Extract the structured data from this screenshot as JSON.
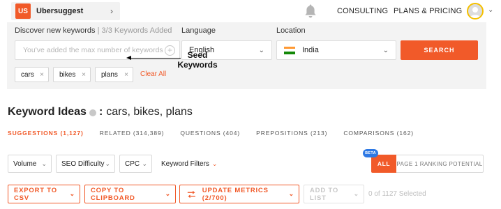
{
  "topbar": {
    "project_badge": "US",
    "project_name": "Ubersuggest",
    "project_chevron": "›",
    "consulting": "CONSULTING",
    "plans_pricing": "PLANS & PRICING",
    "avatar_chevron": "⌄"
  },
  "search": {
    "discover_label": "Discover new keywords",
    "keywords_added": "| 3/3 Keywords Added",
    "input_placeholder": "You've added the max number of keywords",
    "language_label": "Language",
    "language_value": "English",
    "location_label": "Location",
    "location_value": "India",
    "search_button": "SEARCH",
    "seed_keywords": [
      {
        "text": "cars",
        "remove": "×"
      },
      {
        "text": "bikes",
        "remove": "×"
      },
      {
        "text": "plans",
        "remove": "×"
      }
    ],
    "clear_all": "Clear All"
  },
  "annotation": {
    "text": "Seed Keywords"
  },
  "ideas": {
    "title": "Keyword Ideas",
    "colon": ":",
    "keywords": "cars, bikes, plans",
    "tabs": [
      {
        "label": "SUGGESTIONS (1,127)",
        "active": true
      },
      {
        "label": "RELATED (314,389)",
        "active": false
      },
      {
        "label": "QUESTIONS (404)",
        "active": false
      },
      {
        "label": "PREPOSITIONS (213)",
        "active": false
      },
      {
        "label": "COMPARISONS (162)",
        "active": false
      }
    ]
  },
  "filters": {
    "volume": "Volume",
    "seo_difficulty": "SEO Difficulty",
    "cpc": "CPC",
    "keyword_filters": "Keyword Filters",
    "beta": "BETA",
    "all": "ALL",
    "page1": "PAGE 1 RANKING POTENTIAL"
  },
  "actions": {
    "export_csv": "EXPORT TO CSV",
    "copy_clipboard": "COPY TO CLIPBOARD",
    "update_metrics": "UPDATE METRICS (2/700)",
    "add_to_list": "ADD TO LIST",
    "selected": "0 of 1127 Selected"
  },
  "colors": {
    "accent": "#f15a29",
    "panel_bg": "#f3f3f3",
    "beta_blue": "#2e79e4",
    "avatar_ring": "#f5c000"
  }
}
